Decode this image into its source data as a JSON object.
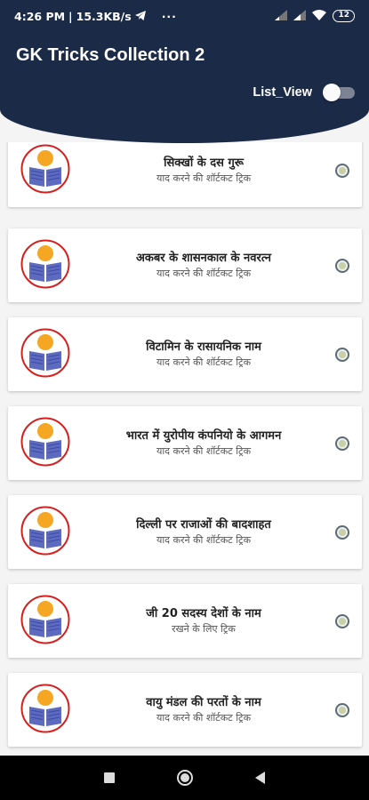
{
  "status_bar": {
    "time": "4:26 PM",
    "network_speed": "15.3KB/s",
    "battery": "12",
    "icons": [
      "telegram-icon",
      "more-dots-icon",
      "signal-icon",
      "signal-icon",
      "wifi-icon",
      "battery-icon"
    ]
  },
  "header": {
    "title": "GK Tricks Collection 2",
    "toggle_label": "List_View",
    "toggle_on": false
  },
  "items": [
    {
      "title": "सिक्खों के दस गुरू",
      "subtitle": "याद करने की शॉर्टकट ट्रिक"
    },
    {
      "title": "अकबर के शासनकाल के नवरत्न",
      "subtitle": "याद करने की शॉर्टकट ट्रिक"
    },
    {
      "title": "विटामिन के रासायनिक नाम",
      "subtitle": "याद करने की शॉर्टकट ट्रिक"
    },
    {
      "title": "भारत में युरोपीय कंपनियो के आगमन",
      "subtitle": "याद करने की शॉर्टकट ट्रिक"
    },
    {
      "title": "दिल्ली पर राजाओं की बादशाहत",
      "subtitle": "याद करने की शॉर्टकट ट्रिक"
    },
    {
      "title": "जी 20 सदस्य देशों के नाम",
      "subtitle": "रखने के लिए ट्रिक"
    },
    {
      "title": "वायु मंडल की परतों के नाम",
      "subtitle": "याद करने की शॉर्टकट ट्रिक"
    }
  ],
  "colors": {
    "header_bg": "#1b2a47",
    "icon_ring": "#d62020",
    "book": "#5c6bc0",
    "reader_head": "#f5a623"
  }
}
